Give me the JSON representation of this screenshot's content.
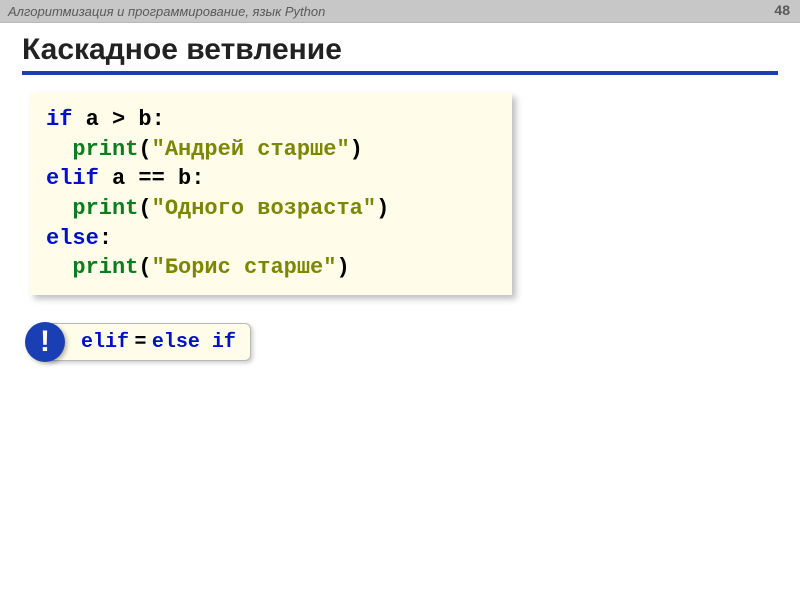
{
  "header": {
    "course": "Алгоритмизация и программирование, язык Python",
    "page": "48"
  },
  "title": "Каскадное ветвление",
  "code": {
    "if_kw": "if",
    "cond1_a": "a",
    "cond1_op": " > ",
    "cond1_b": "b",
    "fn_print": "print",
    "str1": "\"Андрей старше\"",
    "elif_kw": "elif",
    "cond2_a": "a",
    "cond2_op": " == ",
    "cond2_b": "b",
    "str2": "\"Одного возраста\"",
    "else_kw": "else",
    "str3": "\"Борис старше\"",
    "colon": ":",
    "lpar": "(",
    "rpar": ")",
    "indent": "  "
  },
  "note": {
    "bang": "!",
    "elif": "elif",
    "eq": " = ",
    "else": "else",
    "if": "if"
  }
}
